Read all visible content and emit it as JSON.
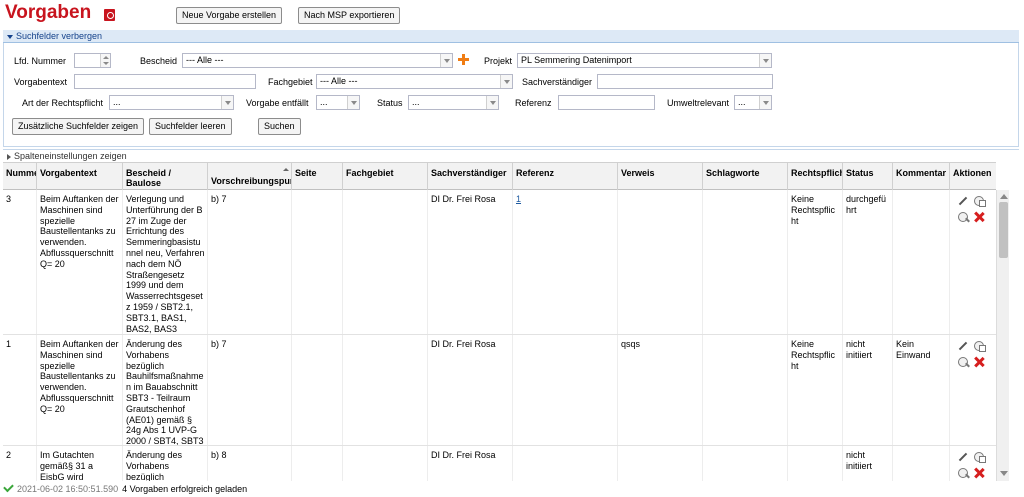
{
  "header": {
    "title": "Vorgaben",
    "new_button": "Neue Vorgabe erstellen",
    "export_button": "Nach MSP exportieren"
  },
  "search_panel": {
    "toggle_label": "Suchfelder verbergen",
    "fields": {
      "lfd_nummer": {
        "label": "Lfd. Nummer",
        "value": ""
      },
      "bescheid": {
        "label": "Bescheid",
        "value": "--- Alle ---"
      },
      "projekt": {
        "label": "Projekt",
        "value": "PL Semmering Datenimport"
      },
      "vorgabentext": {
        "label": "Vorgabentext",
        "value": ""
      },
      "fachgebiet": {
        "label": "Fachgebiet",
        "value": "--- Alle ---"
      },
      "sachverstaendiger": {
        "label": "Sachverständiger",
        "value": ""
      },
      "art_der_rechtspflicht": {
        "label": "Art der Rechtspflicht",
        "value": "..."
      },
      "vorgabe_entfaellt": {
        "label": "Vorgabe entfällt",
        "value": "..."
      },
      "status": {
        "label": "Status",
        "value": "..."
      },
      "referenz": {
        "label": "Referenz",
        "value": ""
      },
      "umweltrelevant": {
        "label": "Umweltrelevant",
        "value": "..."
      }
    },
    "buttons": {
      "more_fields": "Zusätzliche Suchfelder zeigen",
      "clear_fields": "Suchfelder leeren",
      "search": "Suchen"
    }
  },
  "column_settings_label": "Spalteneinstellungen zeigen",
  "grid": {
    "columns": [
      "Nummer",
      "Vorgabentext",
      "Bescheid / Baulose",
      "Vorschreibungspunkt",
      "Seite",
      "Fachgebiet",
      "Sachverständiger",
      "Referenz",
      "Verweis",
      "Schlagworte",
      "Rechtspflicht",
      "Status",
      "Kommentar",
      "Aktionen"
    ],
    "rows": [
      {
        "nummer": "3",
        "vorgabentext": "Beim Auftanken der Maschinen sind spezielle Baustellentanks zu verwenden. Abflussquerschnitt Q= 20",
        "bescheid": "Verlegung und Unterführung der B 27 im Zuge der Errichtung des Semmeringbasistunnel neu, Verfahren nach dem NÖ Straßengesetz 1999 und dem Wasserrechtsgesetz 1959 / SBT2.1, SBT3.1, BAS1, BAS2, BAS3",
        "vorschreibungspunkt": "b) 7",
        "seite": "",
        "fachgebiet": "",
        "sachverstaendiger": "DI Dr. Frei Rosa",
        "referenz": "1",
        "verweis": "",
        "schlagworte": "",
        "rechtspflicht": "Keine Rechtspflicht",
        "status": "durchgeführt",
        "kommentar": ""
      },
      {
        "nummer": "1",
        "vorgabentext": "Beim Auftanken der Maschinen sind spezielle Baustellentanks zu verwenden. Abflussquerschnitt Q= 20",
        "bescheid": "Änderung des Vorhabens bezüglich Bauhilfsmaßnahmen im Bauabschnitt SBT3 - Teilraum Grautschenhof (AE01) gemäß § 24g Abs 1 UVP-G 2000 / SBT4, SBT3",
        "vorschreibungspunkt": "b) 7",
        "seite": "",
        "fachgebiet": "",
        "sachverstaendiger": "DI Dr. Frei Rosa",
        "referenz": "",
        "verweis": "qsqs",
        "schlagworte": "",
        "rechtspflicht": "Keine Rechtspflicht",
        "status": "nicht initiiert",
        "kommentar": "Kein Einwand"
      },
      {
        "nummer": "2",
        "vorgabentext": "Im Gutachten gemäß§ 31 a EisbG wird",
        "bescheid": "Änderung des Vorhabens bezüglich",
        "vorschreibungspunkt": "b) 8",
        "seite": "",
        "fachgebiet": "",
        "sachverstaendiger": "DI Dr. Frei Rosa",
        "referenz": "",
        "verweis": "",
        "schlagworte": "",
        "rechtspflicht": "",
        "status": "nicht initiiert",
        "kommentar": ""
      }
    ]
  },
  "status_bar": {
    "timestamp": "2021-06-02 16:50:51.590",
    "message": "4 Vorgaben erfolgreich geladen"
  },
  "colors": {
    "title_red": "#c8141e",
    "panel_header_bg": "#dde9f6",
    "panel_header_text": "#15428b",
    "plus_orange": "#f07d14",
    "delete_red": "#d61e1e",
    "ok_green": "#3aa63a"
  }
}
